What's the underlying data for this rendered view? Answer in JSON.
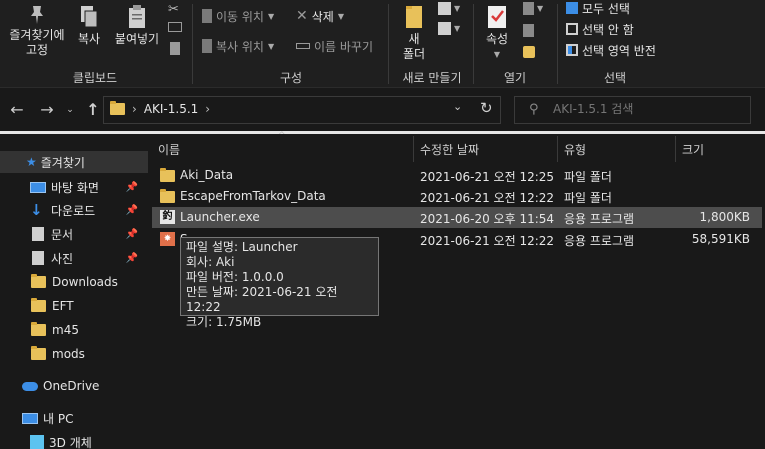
{
  "ribbon": {
    "clipboard": {
      "pin_label": "즐겨찾기에\n고정",
      "copy_label": "복사",
      "paste_label": "붙여넣기",
      "group_label": "클립보드"
    },
    "organize": {
      "move_to": "이동 위치",
      "copy_to": "복사 위치",
      "delete": "삭제",
      "rename": "이름 바꾸기",
      "group_label": "구성"
    },
    "new": {
      "new_folder": "새\n폴더",
      "group_label": "새로 만들기"
    },
    "open": {
      "properties": "속성",
      "group_label": "열기"
    },
    "select": {
      "select_all": "모두 선택",
      "select_none": "선택 안 함",
      "invert": "선택 영역 반전",
      "group_label": "선택"
    }
  },
  "address": {
    "path": "AKI-1.5.1",
    "search_placeholder": "AKI-1.5.1 검색"
  },
  "nav": {
    "quick_access": "즐겨찾기",
    "items": [
      {
        "label": "바탕 화면",
        "pinned": true,
        "icon": "desktop-icon"
      },
      {
        "label": "다운로드",
        "pinned": true,
        "icon": "download-icon"
      },
      {
        "label": "문서",
        "pinned": true,
        "icon": "document-icon"
      },
      {
        "label": "사진",
        "pinned": true,
        "icon": "picture-icon"
      },
      {
        "label": "Downloads",
        "pinned": false,
        "icon": "folder-icon"
      },
      {
        "label": "EFT",
        "pinned": false,
        "icon": "folder-icon"
      },
      {
        "label": "m45",
        "pinned": false,
        "icon": "folder-icon"
      },
      {
        "label": "mods",
        "pinned": false,
        "icon": "folder-icon"
      }
    ],
    "onedrive": "OneDrive",
    "this_pc": "내 PC",
    "objects_3d": "3D 개체"
  },
  "columns": {
    "name": "이름",
    "date": "수정한 날짜",
    "type": "유형",
    "size": "크기"
  },
  "files": [
    {
      "name": "Aki_Data",
      "date": "2021-06-21 오전 12:25",
      "type": "파일 폴더",
      "size": "",
      "icon": "folder-icon"
    },
    {
      "name": "EscapeFromTarkov_Data",
      "date": "2021-06-21 오전 12:22",
      "type": "파일 폴더",
      "size": "",
      "icon": "folder-icon"
    },
    {
      "name": "Launcher.exe",
      "date": "2021-06-20 오후 11:54",
      "type": "응용 프로그램",
      "size": "1,800KB",
      "icon": "launcher-app-icon"
    },
    {
      "name": "S",
      "date": "2021-06-21 오전 12:22",
      "type": "응용 프로그램",
      "size": "58,591KB",
      "icon": "server-app-icon"
    }
  ],
  "tooltip": {
    "line1": "파일 설명: Launcher",
    "line2": "회사: Aki",
    "line3": "파일 버전: 1.0.0.0",
    "line4": "만든 날짜: 2021-06-21 오전 12:22",
    "line5": "크기: 1.75MB"
  },
  "colors": {
    "background": "#191919",
    "ribbon": "#1f1f1f",
    "folder": "#e8c15a",
    "hover_row": "#4d4d4d",
    "selected_nav": "#333333",
    "accent_blue": "#3c8ee6"
  }
}
